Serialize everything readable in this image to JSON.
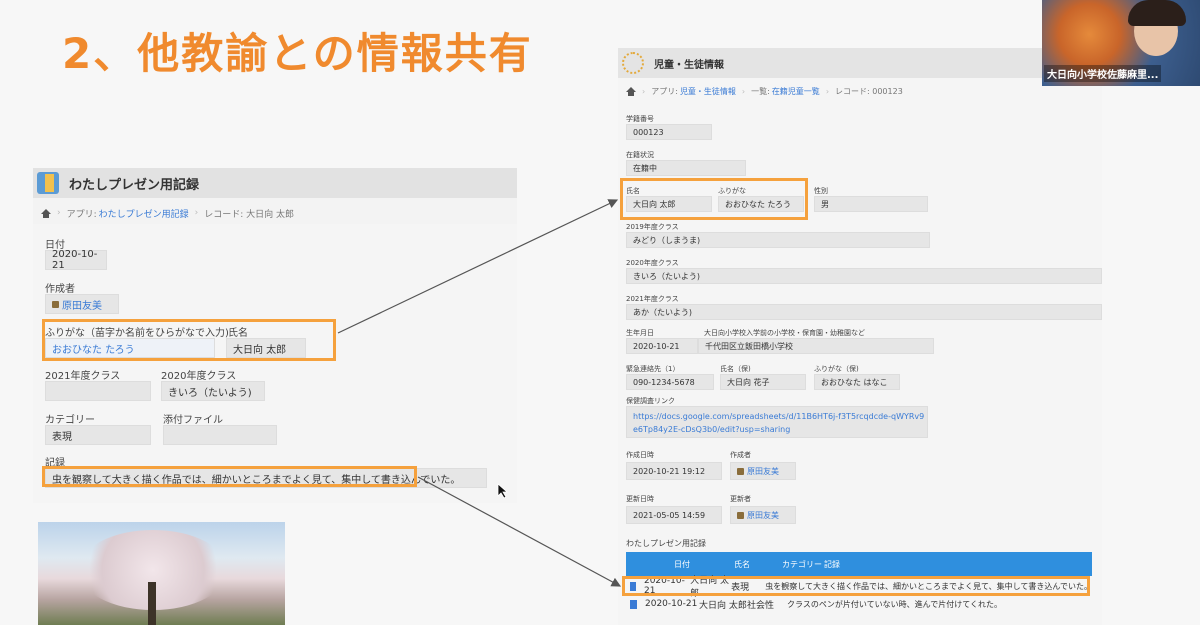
{
  "slide_title": "2、他教諭との情報共有",
  "left_panel": {
    "title": "わたしプレゼン用記録",
    "breadcrumb": {
      "app_prefix": "アプリ:",
      "app_name": "わたしプレゼン用記録",
      "record": "レコード: 大日向 太郎"
    },
    "date_label": "日付",
    "date_value": "2020-10-21",
    "author_label": "作成者",
    "author_value": "原田友美",
    "furigana_label": "ふりがな（苗字か名前をひらがなで入力)",
    "furigana_value": "おおひなた たろう",
    "name_label": "氏名",
    "name_value": "大日向 太郎",
    "class2021_label": "2021年度クラス",
    "class2021_value": "",
    "class2020_label": "2020年度クラス",
    "class2020_value": "きいろ（たいよう)",
    "category_label": "カテゴリー",
    "category_value": "表現",
    "attach_label": "添付ファイル",
    "record_label": "記録",
    "record_value": "虫を観察して大きく描く作品では、細かいところまでよく見て、集中して書き込んでいた。"
  },
  "right_panel": {
    "title": "児童・生徒情報",
    "breadcrumb": {
      "app_prefix": "アプリ:",
      "app_name": "児童・生徒情報",
      "list_prefix": "一覧:",
      "list_name": "在籍児童一覧",
      "record": "レコード: 000123"
    },
    "student_no_label": "学籍番号",
    "student_no_value": "000123",
    "status_label": "在籍状況",
    "status_value": "在籍中",
    "name_label": "氏名",
    "name_value": "大日向 太郎",
    "furigana_label": "ふりがな",
    "furigana_value": "おおひなた たろう",
    "gender_label": "性別",
    "gender_value": "男",
    "class2019_label": "2019年度クラス",
    "class2019_value": "みどり（しまうま)",
    "class2020_label": "2020年度クラス",
    "class2020_value": "きいろ（たいよう)",
    "class2021_label": "2021年度クラス",
    "class2021_value": "あか（たいよう)",
    "birth_label": "生年月日",
    "birth_value": "2020-10-21",
    "school_label": "大日向小学校入学前の小学校・保育園・幼稚園など",
    "school_value": "千代田区立飯田橋小学校",
    "emergency_label": "緊急連絡先（1）",
    "emergency_value": "090-1234-5678",
    "guardian_name_label": "氏名（保)",
    "guardian_name_value": "大日向 花子",
    "guardian_furi_label": "ふりがな（保)",
    "guardian_furi_value": "おおひなた はなこ",
    "survey_label": "保健調査リンク",
    "survey_value": "https://docs.google.com/spreadsheets/d/11B6HT6j-f3T5rcqdcde-qWYRv9e6Tp84y2E-cDsQ3b0/edit?usp=sharing",
    "created_label": "作成日時",
    "created_value": "2020-10-21 19:12",
    "creator_label": "作成者",
    "creator_value": "原田友美",
    "updated_label": "更新日時",
    "updated_value": "2021-05-05 14:59",
    "updater_label": "更新者",
    "updater_value": "原田友美",
    "subtable_title": "わたしプレゼン用記録",
    "subtable_headers": [
      "日付",
      "氏名",
      "カテゴリー",
      "記録"
    ],
    "subtable_rows": [
      {
        "date": "2020-10-21",
        "name": "大日向 太郎",
        "category": "表現",
        "record": "虫を観察して大きく描く作品では、細かいところまでよく見て、集中して書き込んでいた。"
      },
      {
        "date": "2020-10-21",
        "name": "大日向 太郎",
        "category": "社会性",
        "record": "クラスのペンが片付いていない時、進んで片付けてくれた。"
      }
    ]
  },
  "webcam": {
    "caption": "大日向小学校佐藤麻里..."
  },
  "colors": {
    "accent": "#f08a2e",
    "highlight": "#f5a13d",
    "table_header": "#2f8fde",
    "link": "#3a7bd5"
  }
}
